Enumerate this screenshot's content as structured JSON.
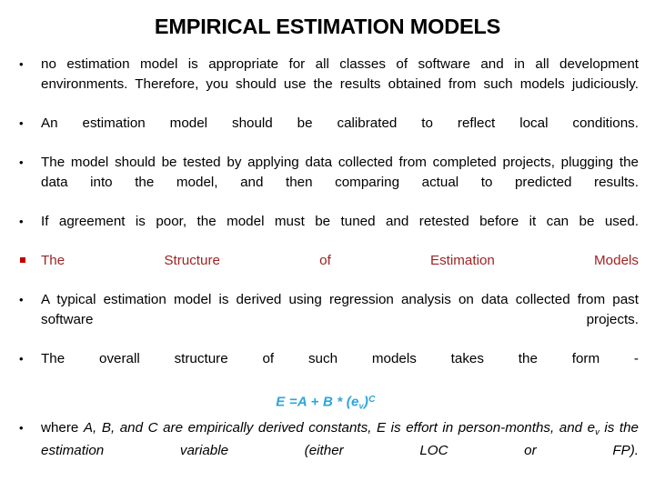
{
  "slide": {
    "title": "EMPIRICAL ESTIMATION MODELS",
    "background_color": "#FFFFFF",
    "text_color": "#000000",
    "accent_red": "#9F2324",
    "bullet_red": "#C00000",
    "accent_blue": "#2BA6D9"
  },
  "bullets": [
    {
      "marker": "round-dot",
      "text": "no estimation model is appropriate for all classes of software and in all development environments. Therefore, you should use the results obtained from such models judiciously."
    },
    {
      "marker": "round-dot",
      "text": "An estimation model should be calibrated to reflect local conditions."
    },
    {
      "marker": "round-dot",
      "text": " The model should be tested by applying data collected from completed projects, plugging the data into the model, and then comparing actual to predicted results."
    },
    {
      "marker": "round-dot",
      "text": " If agreement is poor, the model must be tuned and retested before it can be used."
    },
    {
      "marker": "square",
      "text": " The Structure of Estimation Models"
    },
    {
      "marker": "round-dot",
      "text": "A typical estimation model is derived using regression analysis on data collected from past software projects."
    },
    {
      "marker": "round-dot",
      "text": "The overall structure of such models takes the form -"
    }
  ],
  "formula": {
    "lead": "E  =A + B * (e",
    "subscript": "v",
    "mid": ")",
    "superscript": "C"
  },
  "closing_bullet": {
    "marker": "round-dot",
    "upright_prefix": "where ",
    "italic_part_1": "A, B, and C are empirically derived constants, E is effort in person-months, and  e",
    "subscript": "v",
    "italic_part_2": " is the estimation variable (either LOC or FP)."
  }
}
